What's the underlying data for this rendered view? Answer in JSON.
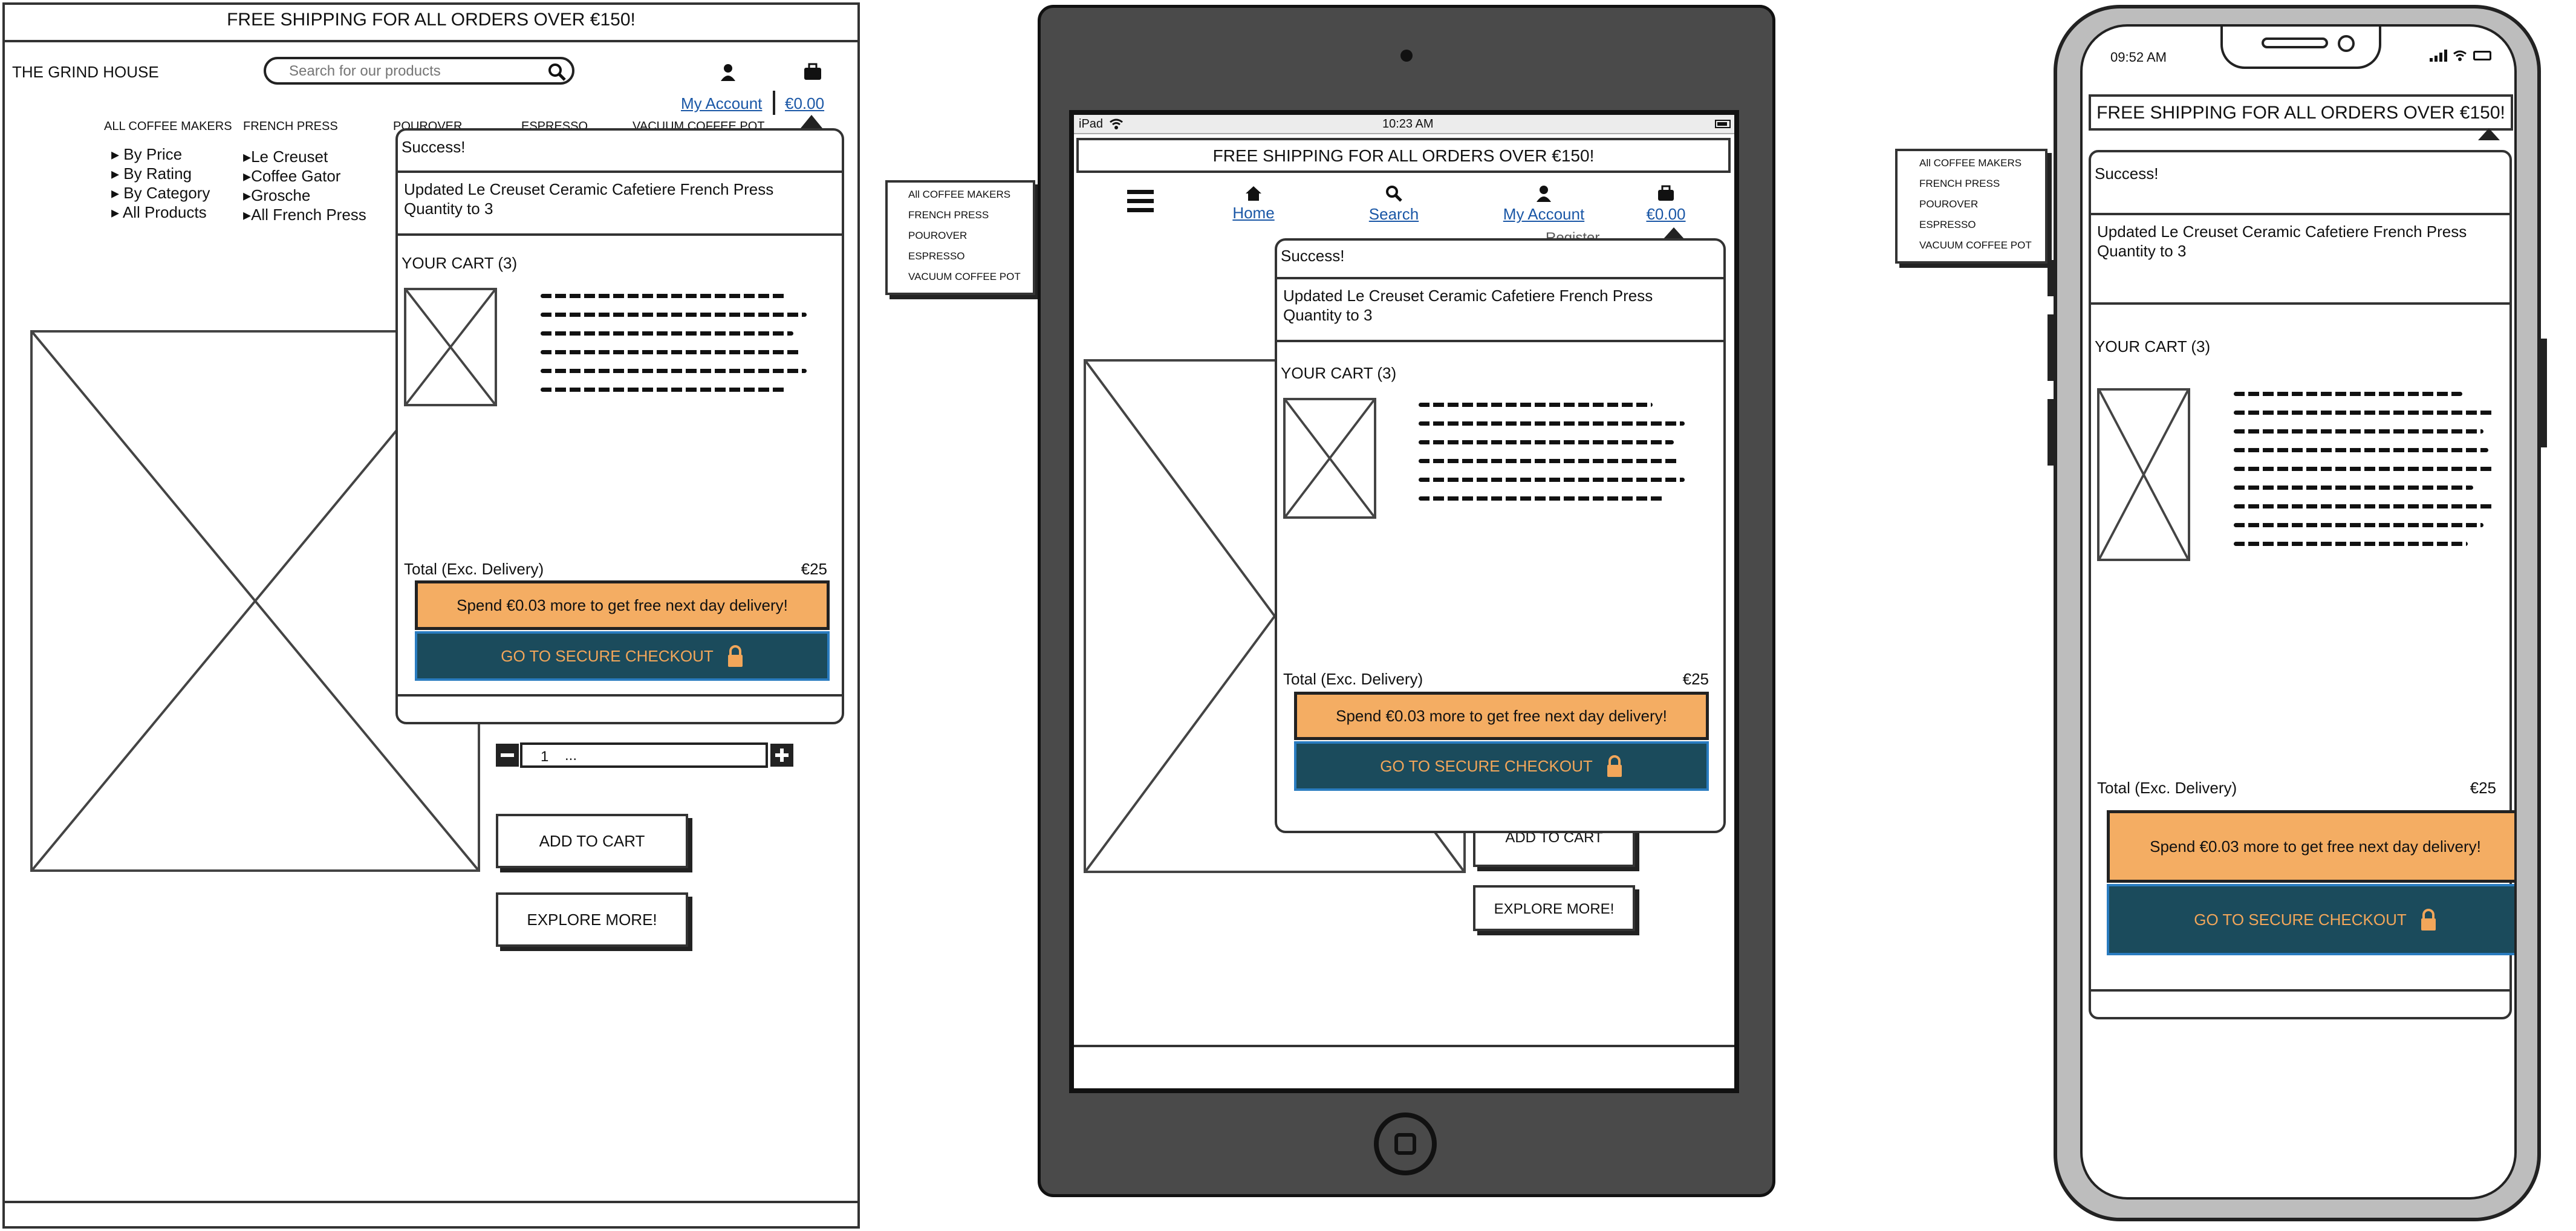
{
  "shipping_banner": "FREE SHIPPING FOR ALL ORDERS OVER €150!",
  "desktop": {
    "logo": "THE GRIND HOUSE",
    "search_placeholder": "Search for our products",
    "my_account": "My Account",
    "cart_total": "€0.00",
    "nav": [
      "ALL COFFEE MAKERS",
      "FRENCH PRESS",
      "POUROVER",
      "ESPRESSO",
      "VACUUM COFFEE POT"
    ],
    "all_makers_items": [
      "By Price",
      "By Rating",
      "By Category",
      "All Products"
    ],
    "french_press_items": [
      "Le Creuset",
      "Coffee Gator",
      "Grosche",
      "All French Press"
    ],
    "quantity": "1",
    "quantity_dots": "...",
    "add_to_cart": "ADD TO CART",
    "explore_more": "EXPLORE MORE!"
  },
  "cart_popup": {
    "success": "Success!",
    "updated_line1": "Updated Le Creuset Ceramic Cafetiere French Press",
    "updated_line2": "Quantity to 3",
    "your_cart": "YOUR CART (3)",
    "total_label": "Total (Exc. Delivery)",
    "total_value": "€25",
    "spend_more": "Spend €0.03 more to get free next day delivery!",
    "checkout": "GO TO SECURE CHECKOUT"
  },
  "side_menu": [
    "All COFFEE MAKERS",
    "FRENCH PRESS",
    "POUROVER",
    "ESPRESSO",
    "VACUUM COFFEE POT"
  ],
  "tablet": {
    "status_device": "iPad",
    "status_time": "10:23 AM",
    "nav": [
      "Home",
      "Search",
      "My Account",
      "€0.00"
    ],
    "register_partial": "Register",
    "add_to_cart": "ADD TO CART",
    "explore_more": "EXPLORE MORE!"
  },
  "phone_menu": [
    "All COFFEE MAKERS",
    "FRENCH PRESS",
    "POUROVER",
    "ESPRESSO",
    "VACUUM COFFEE POT"
  ],
  "phone": {
    "status_time": "09:52 AM"
  },
  "colors": {
    "orange": "#f4ad63",
    "teal": "#1b4b5c",
    "link_blue": "#1a57a6",
    "device_dark": "#4a4a4a"
  }
}
